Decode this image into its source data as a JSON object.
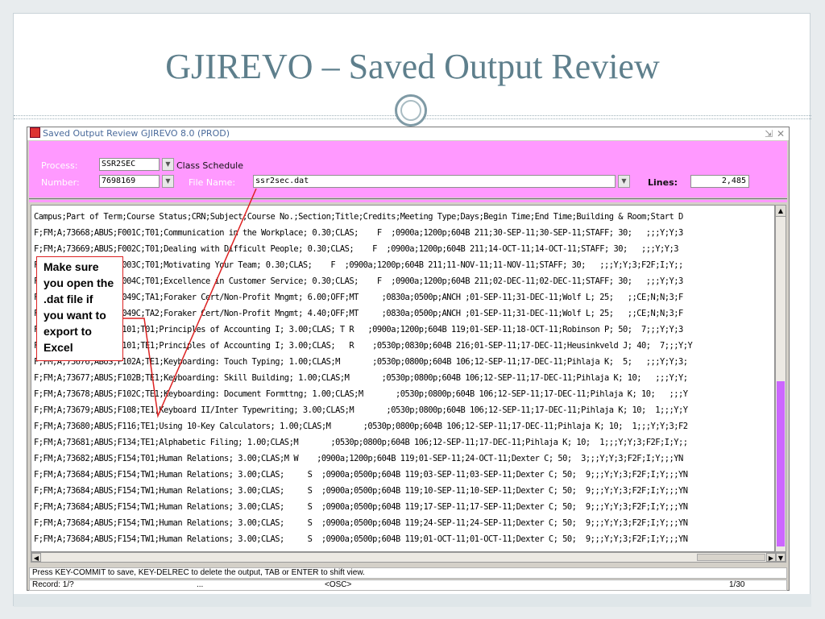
{
  "slide": {
    "title": "GJIREVO – Saved Output Review"
  },
  "window": {
    "title": "Saved Output Review  GJIREVO  8.0  (PROD)"
  },
  "form": {
    "process_label": "Process:",
    "process_value": "SSR2SEC",
    "process_desc": "Class Schedule",
    "number_label": "Number:",
    "number_value": "7698169",
    "file_label": "File Name:",
    "file_value": "ssr2sec.dat",
    "lines_label": "Lines:",
    "lines_value": "2,485"
  },
  "output": {
    "lines": [
      "Campus;Part of Term;Course Status;CRN;Subject;Course No.;Section;Title;Credits;Meeting Type;Days;Begin Time;End Time;Building & Room;Start D",
      "F;FM;A;73668;ABUS;F001C;T01;Communication in the Workplace; 0.30;CLAS;    F  ;0900a;1200p;604B 211;30-SEP-11;30-SEP-11;STAFF; 30;   ;;;Y;Y;3",
      "F;FM;A;73669;ABUS;F002C;T01;Dealing with Difficult People; 0.30;CLAS;    F  ;0900a;1200p;604B 211;14-OCT-11;14-OCT-11;STAFF; 30;   ;;;Y;Y;3",
      "F;FM;A;73670;ABUS;F003C;T01;Motivating Your Team; 0.30;CLAS;    F  ;0900a;1200p;604B 211;11-NOV-11;11-NOV-11;STAFF; 30;   ;;;Y;Y;3;F2F;I;Y;;",
      "F;FM;A;73671;ABUS;F004C;T01;Excellence in Customer Service; 0.30;CLAS;    F  ;0900a;1200p;604B 211;02-DEC-11;02-DEC-11;STAFF; 30;   ;;;Y;Y;3",
      "F;FM;A;73672;ABUS;F049C;TA1;Foraker Cert/Non-Profit Mngmt; 6.00;OFF;MT     ;0830a;0500p;ANCH ;01-SEP-11;31-DEC-11;Wolf L; 25;   ;;CE;N;N;3;F",
      "F;FM;A;73673;ABUS;F049C;TA2;Foraker Cert/Non-Profit Mngmt; 4.40;OFF;MT     ;0830a;0500p;ANCH ;01-SEP-11;31-DEC-11;Wolf L; 25;   ;;CE;N;N;3;F",
      "F;FM;A;73674;ABUS;F101;T01;Principles of Accounting I; 3.00;CLAS; T R   ;0900a;1200p;604B 119;01-SEP-11;18-OCT-11;Robinson P; 50;  7;;;Y;Y;3",
      "F;FM;A;73675;ABUS;F101;TE1;Principles of Accounting I; 3.00;CLAS;   R    ;0530p;0830p;604B 216;01-SEP-11;17-DEC-11;Heusinkveld J; 40;  7;;;Y;Y",
      "F;FM;A;73676;ABUS;F102A;TE1;Keyboarding: Touch Typing; 1.00;CLAS;M       ;0530p;0800p;604B 106;12-SEP-11;17-DEC-11;Pihlaja K;  5;   ;;;Y;Y;3;",
      "F;FM;A;73677;ABUS;F102B;TE1;Keyboarding: Skill Building; 1.00;CLAS;M       ;0530p;0800p;604B 106;12-SEP-11;17-DEC-11;Pihlaja K; 10;   ;;;Y;Y;",
      "F;FM;A;73678;ABUS;F102C;TE1;Keyboarding: Document Formttng; 1.00;CLAS;M       ;0530p;0800p;604B 106;12-SEP-11;17-DEC-11;Pihlaja K; 10;   ;;;Y",
      "F;FM;A;73679;ABUS;F108;TE1;Keyboard II/Inter Typewriting; 3.00;CLAS;M       ;0530p;0800p;604B 106;12-SEP-11;17-DEC-11;Pihlaja K; 10;  1;;;Y;Y",
      "F;FM;A;73680;ABUS;F116;TE1;Using 10-Key Calculators; 1.00;CLAS;M       ;0530p;0800p;604B 106;12-SEP-11;17-DEC-11;Pihlaja K; 10;  1;;;Y;Y;3;F2",
      "F;FM;A;73681;ABUS;F134;TE1;Alphabetic Filing; 1.00;CLAS;M       ;0530p;0800p;604B 106;12-SEP-11;17-DEC-11;Pihlaja K; 10;  1;;;Y;Y;3;F2F;I;Y;;",
      "F;FM;A;73682;ABUS;F154;T01;Human Relations; 3.00;CLAS;M W    ;0900a;1200p;604B 119;01-SEP-11;24-OCT-11;Dexter C; 50;  3;;;Y;Y;3;F2F;I;Y;;;YN",
      "F;FM;A;73684;ABUS;F154;TW1;Human Relations; 3.00;CLAS;     S  ;0900a;0500p;604B 119;03-SEP-11;03-SEP-11;Dexter C; 50;  9;;;Y;Y;3;F2F;I;Y;;;YN",
      "F;FM;A;73684;ABUS;F154;TW1;Human Relations; 3.00;CLAS;     S  ;0900a;0500p;604B 119;10-SEP-11;10-SEP-11;Dexter C; 50;  9;;;Y;Y;3;F2F;I;Y;;;YN",
      "F;FM;A;73684;ABUS;F154;TW1;Human Relations; 3.00;CLAS;     S  ;0900a;0500p;604B 119;17-SEP-11;17-SEP-11;Dexter C; 50;  9;;;Y;Y;3;F2F;I;Y;;;YN",
      "F;FM;A;73684;ABUS;F154;TW1;Human Relations; 3.00;CLAS;     S  ;0900a;0500p;604B 119;24-SEP-11;24-SEP-11;Dexter C; 50;  9;;;Y;Y;3;F2F;I;Y;;;YN",
      "F;FM;A;73684;ABUS;F154;TW1;Human Relations; 3.00;CLAS;     S  ;0900a;0500p;604B 119;01-OCT-11;01-OCT-11;Dexter C; 50;  9;;;Y;Y;3;F2F;I;Y;;;YN"
    ]
  },
  "status": {
    "hint": "Press KEY-COMMIT to save, KEY-DELREC to delete the output, TAB or ENTER to shift view.",
    "record": "Record: 1/?",
    "ellipsis": "...",
    "osc": "<OSC>",
    "page": "1/30"
  },
  "callout": {
    "lines": [
      "Make sure",
      "you open the",
      ".dat file if",
      "you want to",
      "export to",
      "Excel"
    ],
    "color": "#dd2222"
  },
  "colors": {
    "form_bg": "#ff99ff",
    "title": "#5e7f8c",
    "scroll_thumb": "#cc66ff"
  }
}
